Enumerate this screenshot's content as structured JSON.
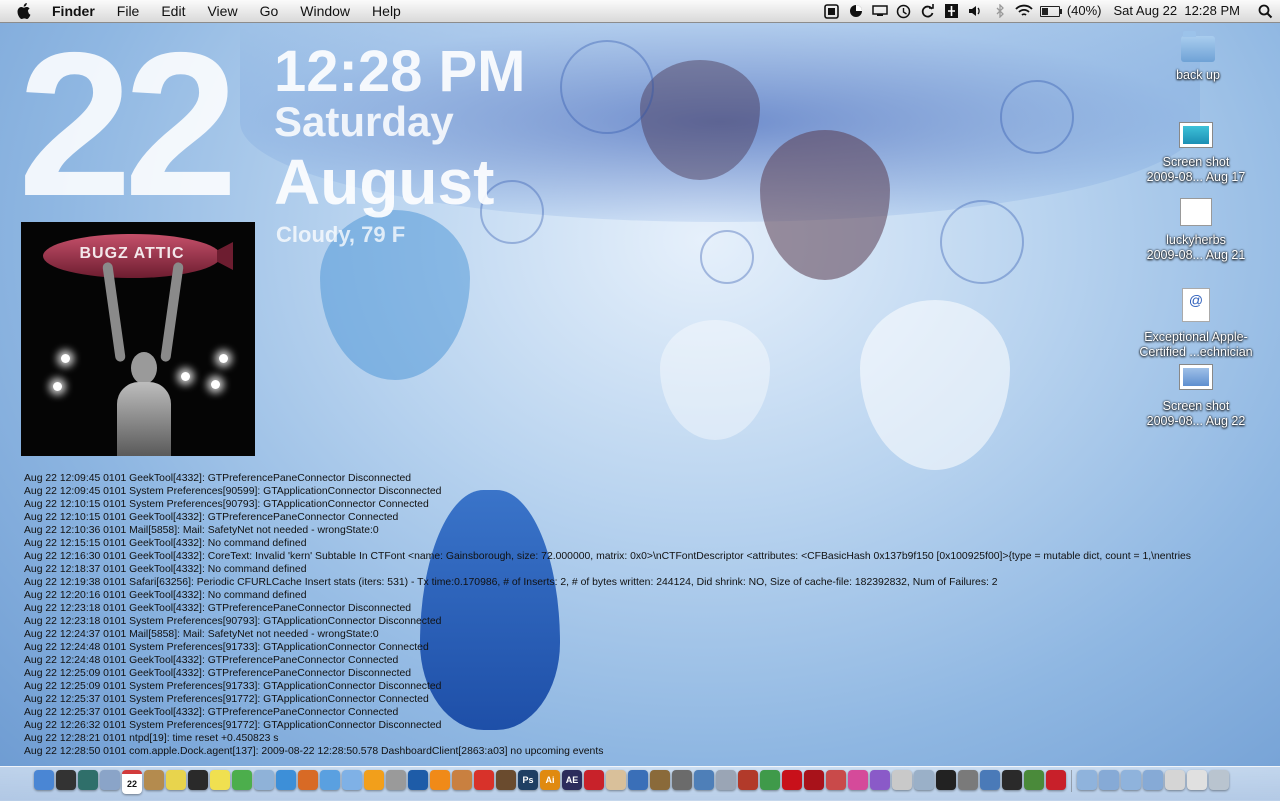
{
  "menubar": {
    "app_name": "Finder",
    "menus": [
      "File",
      "Edit",
      "View",
      "Go",
      "Window",
      "Help"
    ],
    "battery_percent": "(40%)",
    "battery_level": 0.4,
    "clock": "Sat Aug 22  12:28 PM"
  },
  "geektool": {
    "day": "22",
    "time": "12:28 PM",
    "weekday": "Saturday",
    "month": "August",
    "weather": "Cloudy, 79 F"
  },
  "album": {
    "blimp_text": "BUGZ ATTIC"
  },
  "console": {
    "lines": [
      "Aug 22 12:09:45 0101 GeekTool[4332]: GTPreferencePaneConnector Disconnected",
      "Aug 22 12:09:45 0101 System Preferences[90599]: GTApplicationConnector Disconnected",
      "Aug 22 12:10:15 0101 System Preferences[90793]: GTApplicationConnector Connected",
      "Aug 22 12:10:15 0101 GeekTool[4332]: GTPreferencePaneConnector Connected",
      "Aug 22 12:10:36 0101 Mail[5858]: Mail: SafetyNet not needed - wrongState:0",
      "Aug 22 12:15:15 0101 GeekTool[4332]: No command defined",
      "Aug 22 12:16:30 0101 GeekTool[4332]: CoreText: Invalid 'kern' Subtable In CTFont <name: Gainsborough, size: 72.000000, matrix: 0x0>\\nCTFontDescriptor <attributes: <CFBasicHash 0x137b9f150 [0x100925f00]>{type = mutable dict, count = 1,\\nentries",
      "Aug 22 12:18:37 0101 GeekTool[4332]: No command defined",
      "Aug 22 12:19:38 0101 Safari[63256]: Periodic CFURLCache Insert stats (iters: 531) - Tx time:0.170986, # of Inserts: 2, # of bytes written: 244124, Did shrink: NO, Size of cache-file: 182392832, Num of Failures: 2",
      "Aug 22 12:20:16 0101 GeekTool[4332]: No command defined",
      "Aug 22 12:23:18 0101 GeekTool[4332]: GTPreferencePaneConnector Disconnected",
      "Aug 22 12:23:18 0101 System Preferences[90793]: GTApplicationConnector Disconnected",
      "Aug 22 12:24:37 0101 Mail[5858]: Mail: SafetyNet not needed - wrongState:0",
      "Aug 22 12:24:48 0101 System Preferences[91733]: GTApplicationConnector Connected",
      "Aug 22 12:24:48 0101 GeekTool[4332]: GTPreferencePaneConnector Connected",
      "Aug 22 12:25:09 0101 GeekTool[4332]: GTPreferencePaneConnector Disconnected",
      "Aug 22 12:25:09 0101 System Preferences[91733]: GTApplicationConnector Disconnected",
      "Aug 22 12:25:37 0101 System Preferences[91772]: GTApplicationConnector Connected",
      "Aug 22 12:25:37 0101 GeekTool[4332]: GTPreferencePaneConnector Connected",
      "Aug 22 12:26:32 0101 System Preferences[91772]: GTApplicationConnector Disconnected",
      "Aug 22 12:28:21 0101 ntpd[19]: time reset +0.450823 s",
      "Aug 22 12:28:50 0101 com.apple.Dock.agent[137]: 2009-08-22 12:28:50.578 DashboardClient[2863:a03] no upcoming events"
    ]
  },
  "desktop": {
    "icons": [
      {
        "line1": "back up",
        "line2": "",
        "kind": "folder"
      },
      {
        "line1": "Screen shot",
        "line2": "2009-08... Aug 17",
        "kind": "screenshot"
      },
      {
        "line1": "luckyherbs",
        "line2": "2009-08... Aug 21",
        "kind": "document"
      },
      {
        "line1": "Exceptional Apple-",
        "line2": "Certified ...echnician",
        "kind": "webloc"
      },
      {
        "line1": "Screen shot",
        "line2": "2009-08... Aug 22",
        "kind": "screenshot"
      }
    ]
  },
  "dock": {
    "calendar_day": "22",
    "apps": [
      {
        "name": "finder-icon",
        "color": "#4a86d4"
      },
      {
        "name": "dashboard-icon",
        "color": "#333333"
      },
      {
        "name": "time-machine-icon",
        "color": "#2f6f6a"
      },
      {
        "name": "mail-icon",
        "color": "#8aa4c8"
      },
      {
        "name": "calendar-icon",
        "color": "#d23b3b"
      },
      {
        "name": "address-book-icon",
        "color": "#b48b4e"
      },
      {
        "name": "stickies-icon",
        "color": "#e8d44d"
      },
      {
        "name": "skype-icon",
        "color": "#2a2a2a"
      },
      {
        "name": "notes-icon",
        "color": "#f0e050"
      },
      {
        "name": "evernote-icon",
        "color": "#4cae4c"
      },
      {
        "name": "preview-icon",
        "color": "#8fb2d8"
      },
      {
        "name": "safari-icon",
        "color": "#3d8fd8"
      },
      {
        "name": "firefox-icon",
        "color": "#d86a25"
      },
      {
        "name": "ichat-icon",
        "color": "#5aa0e0"
      },
      {
        "name": "itunes-icon",
        "color": "#7fb1e6"
      },
      {
        "name": "stanza-icon",
        "color": "#f29f1b"
      },
      {
        "name": "transmission-icon",
        "color": "#9a9a9a"
      },
      {
        "name": "quicktime-icon",
        "color": "#1e5ca8"
      },
      {
        "name": "vlc-icon",
        "color": "#f08a18"
      },
      {
        "name": "pencil-icon",
        "color": "#c98040"
      },
      {
        "name": "tomato-icon",
        "color": "#d8322a"
      },
      {
        "name": "photo-booth-icon",
        "color": "#6a4b2e"
      },
      {
        "name": "photoshop-icon",
        "color": "#1f3f63",
        "label": "Ps"
      },
      {
        "name": "illustrator-icon",
        "color": "#e08a10",
        "label": "Ai"
      },
      {
        "name": "after-effects-icon",
        "color": "#2c2c5c",
        "label": "AE"
      },
      {
        "name": "acrobat-icon",
        "color": "#c8222a"
      },
      {
        "name": "textedit-icon",
        "color": "#d9c09a"
      },
      {
        "name": "system-profiler-icon",
        "color": "#3a6fb8"
      },
      {
        "name": "utility-icon",
        "color": "#8a6a3a"
      },
      {
        "name": "tools-icon",
        "color": "#6b6b6b"
      },
      {
        "name": "network-icon",
        "color": "#4e7fb8"
      },
      {
        "name": "xcode-icon",
        "color": "#9aa5b5"
      },
      {
        "name": "presenter-icon",
        "color": "#b23a2a"
      },
      {
        "name": "grapher-icon",
        "color": "#3f9a4a"
      },
      {
        "name": "red-app-icon",
        "color": "#c8101a"
      },
      {
        "name": "red-book-icon",
        "color": "#a8121a"
      },
      {
        "name": "font-book-icon",
        "color": "#c94a4a"
      },
      {
        "name": "pink-app-icon",
        "color": "#d54a9a"
      },
      {
        "name": "purple-app-icon",
        "color": "#8a5ac8"
      },
      {
        "name": "files-icon",
        "color": "#c9c9c9"
      },
      {
        "name": "screenshot-app-icon",
        "color": "#9ab0c8"
      },
      {
        "name": "terminal-icon",
        "color": "#222222"
      },
      {
        "name": "calculator-icon",
        "color": "#7a7a7a"
      },
      {
        "name": "display-icon",
        "color": "#4a7ab8"
      },
      {
        "name": "activity-monitor-icon",
        "color": "#2a2a2a"
      },
      {
        "name": "bape-icon",
        "color": "#4a8a3a"
      },
      {
        "name": "parallels-icon",
        "color": "#c8202a"
      }
    ],
    "stacks": [
      {
        "name": "stack-applications-icon",
        "color": "#8fb3dc"
      },
      {
        "name": "stack-documents-icon",
        "color": "#86aad6"
      },
      {
        "name": "stack-downloads-icon",
        "color": "#8fb3dc"
      },
      {
        "name": "stack-music-icon",
        "color": "#86aad6"
      },
      {
        "name": "stack-printer-icon",
        "color": "#d5d5d5"
      },
      {
        "name": "stack-mail-icon",
        "color": "#e0e0e0"
      },
      {
        "name": "trash-icon",
        "color": "#b9c4cf"
      }
    ]
  }
}
